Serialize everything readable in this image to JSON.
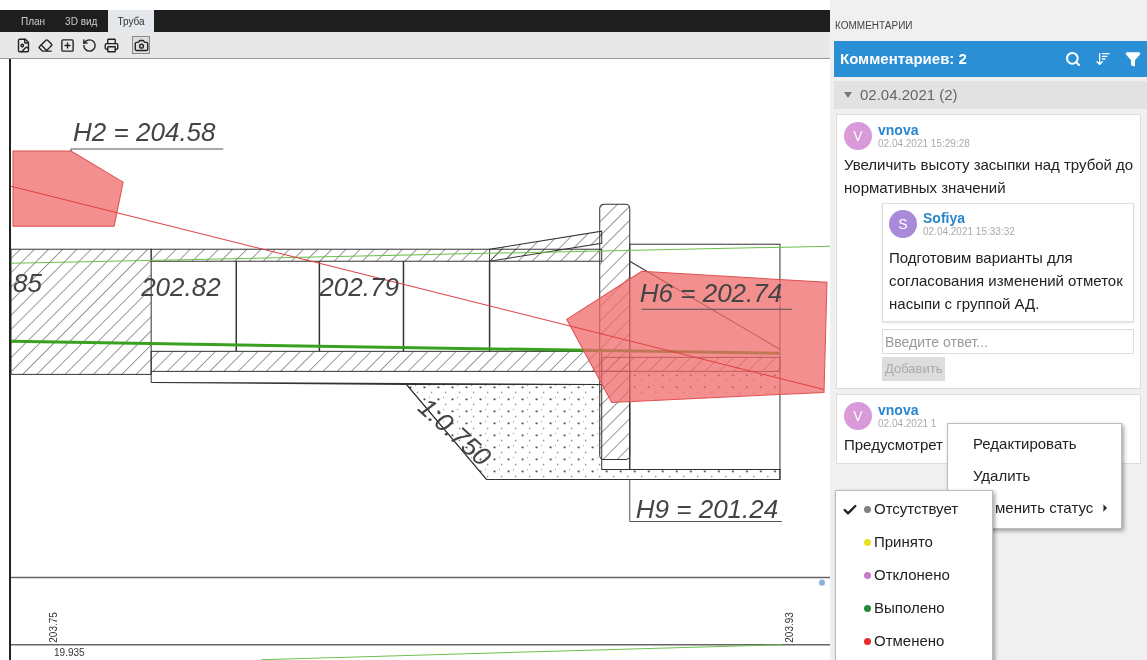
{
  "tabs": [
    {
      "label": "План",
      "selected": false
    },
    {
      "label": "3D вид",
      "selected": false
    },
    {
      "label": "Труба",
      "selected": true
    }
  ],
  "drawing": {
    "labels": [
      "H2 = 204.58",
      "85",
      "202.82",
      "202.79",
      "H6 = 202.74",
      "1:0.750",
      "H9 = 201.24"
    ],
    "profile_labels": [
      "203.75",
      "203.93",
      "19.935"
    ]
  },
  "comments_panel": {
    "title": "КОММЕНТАРИИ",
    "count_label": "Комментариев: 2",
    "group": {
      "label": "02.04.2021 (2)",
      "expanded": true
    },
    "comments": [
      {
        "avatar": "V",
        "color": "#d89ad8",
        "author": "vnova",
        "time": "02.04.2021 15:29:28",
        "text": "Увеличить высоту засыпки над трубой до нормативных значений",
        "replies": [
          {
            "avatar": "S",
            "color": "#a98ad8",
            "author": "Sofiya",
            "time": "02.04.2021 15:33:32",
            "text": "Подготовим варианты для согласования изменений отметок насыпи с группой АД."
          }
        ],
        "reply_placeholder": "Введите ответ...",
        "add_button": {
          "label": "Добавить",
          "disabled": true
        }
      },
      {
        "avatar": "V",
        "color": "#d89ad8",
        "author": "vnova",
        "time": "02.04.2021 1",
        "text": "Предусмотрет"
      }
    ]
  },
  "context_menu": {
    "items": [
      {
        "label": "Редактировать",
        "submenu": false
      },
      {
        "label": "Удалить",
        "submenu": false
      },
      {
        "label": "менить статус",
        "submenu": true
      }
    ]
  },
  "status_menu": {
    "items": [
      {
        "label": "Отсутствует",
        "color": "#808080",
        "selected": true
      },
      {
        "label": "Принято",
        "color": "#e8e020",
        "selected": false
      },
      {
        "label": "Отклонено",
        "color": "#c87ac8",
        "selected": false
      },
      {
        "label": "Выполено",
        "color": "#1e8a3a",
        "selected": false
      },
      {
        "label": "Отменено",
        "color": "#e82a2a",
        "selected": false
      }
    ]
  }
}
